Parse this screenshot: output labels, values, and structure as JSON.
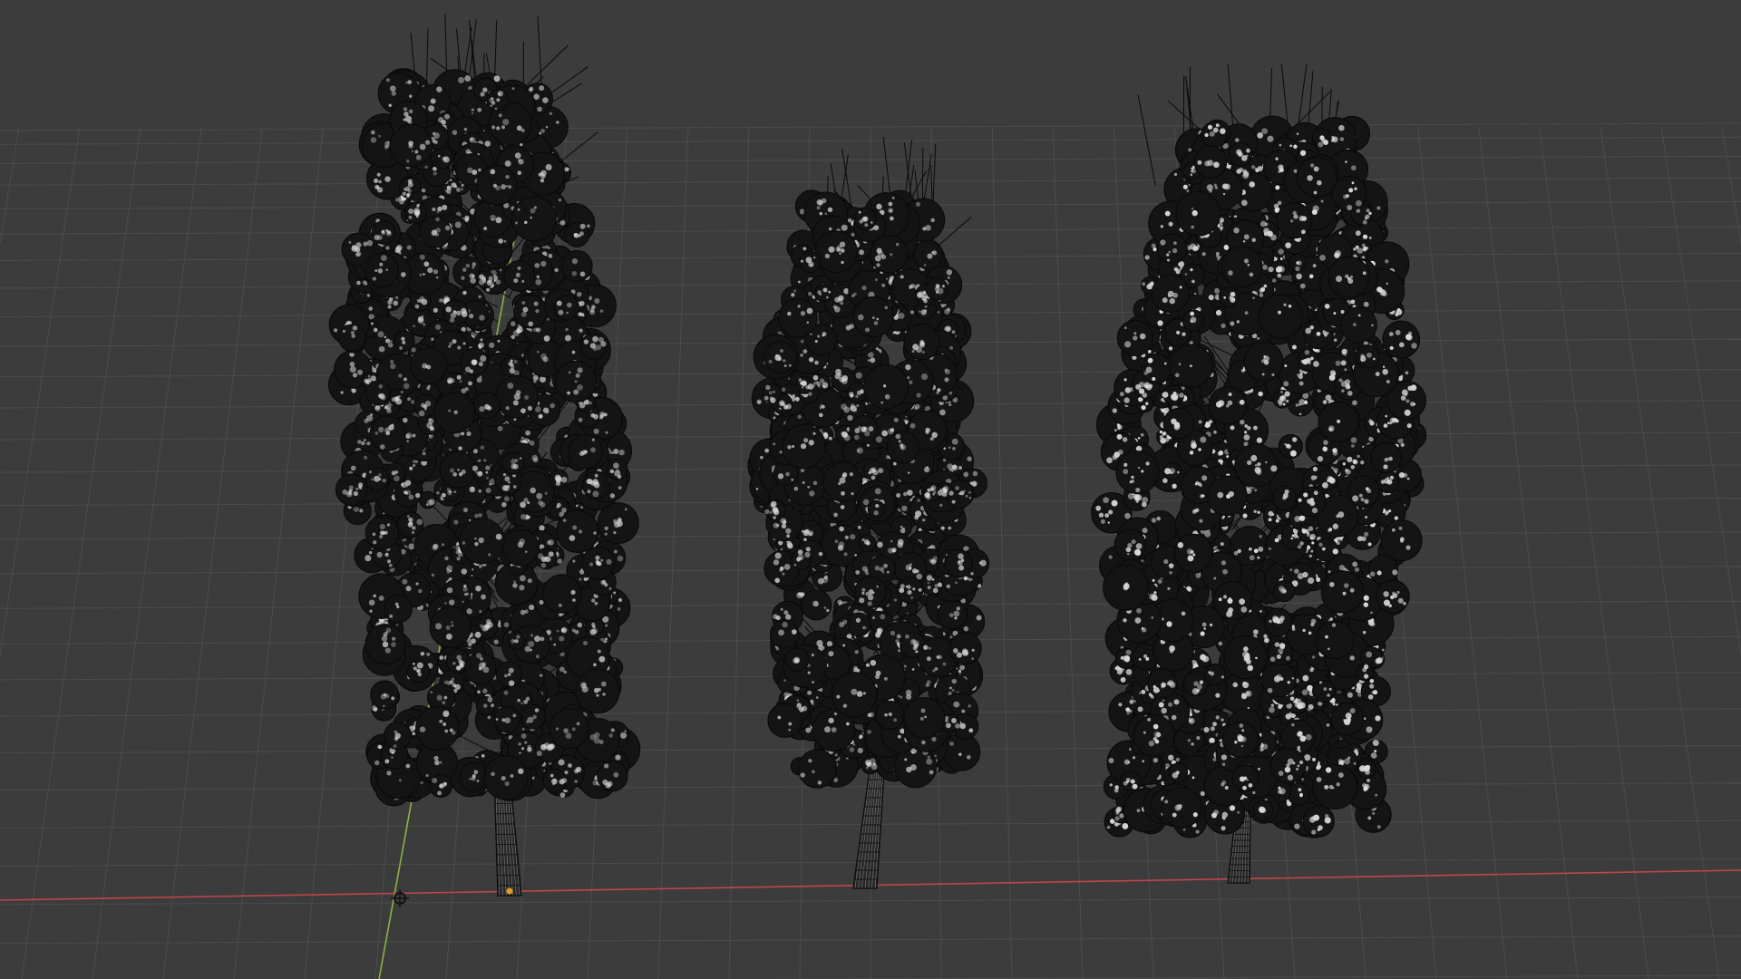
{
  "viewport": {
    "mode": "wireframe",
    "background_color": "#3c3c3c",
    "grid_color": "#4c4c4c",
    "x_axis_color": "#c0454c",
    "y_axis_color": "#8bb33e",
    "wire_color": "#0a0a0a",
    "highlight_color": "#d8d8d8",
    "origin_color": "#e69a1e",
    "objects": [
      {
        "name": "tree-left",
        "type": "tree-mesh",
        "selected": false
      },
      {
        "name": "tree-center",
        "type": "tree-mesh",
        "selected": false
      },
      {
        "name": "tree-right",
        "type": "tree-mesh",
        "selected": false
      }
    ],
    "cursor_icon": "3d-cursor-icon",
    "origin_icon": "object-origin-icon"
  }
}
